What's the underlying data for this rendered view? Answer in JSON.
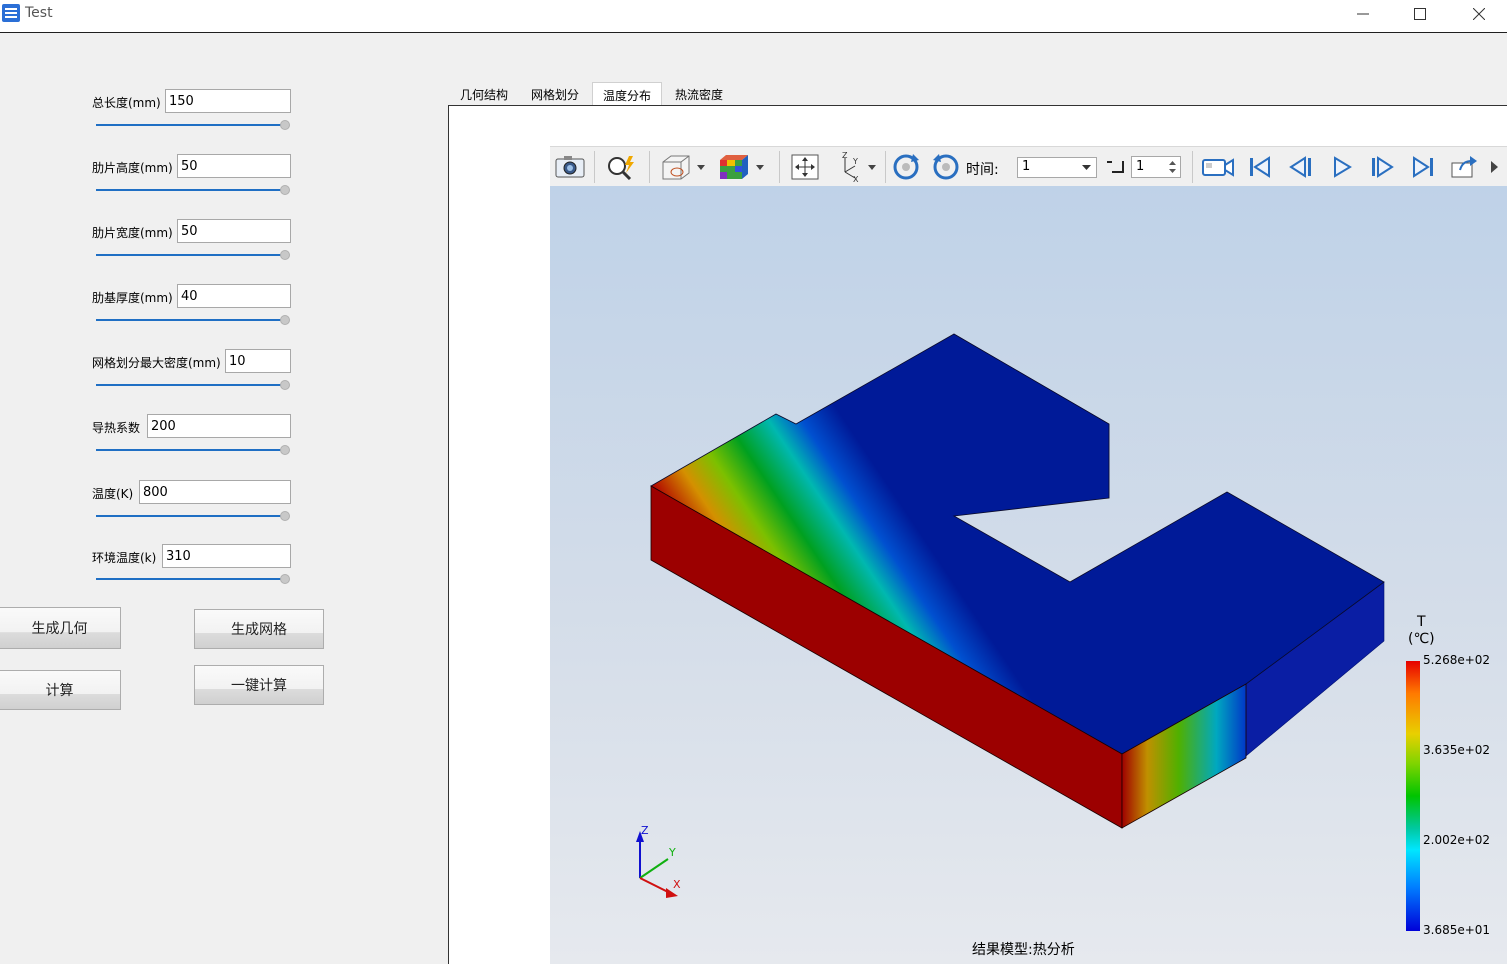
{
  "window": {
    "title": "Test",
    "controls": [
      "minimize",
      "maximize",
      "close"
    ]
  },
  "params": [
    {
      "label": "总长度(mm)",
      "value": "150"
    },
    {
      "label": "肋片高度(mm)",
      "value": "50"
    },
    {
      "label": "肋片宽度(mm)",
      "value": "50"
    },
    {
      "label": "肋基厚度(mm)",
      "value": "40"
    },
    {
      "label": "网格划分最大密度(mm)",
      "value": "10"
    },
    {
      "label": "导热系数",
      "value": "200"
    },
    {
      "label": "温度(K)",
      "value": "800"
    },
    {
      "label": "环境温度(k)",
      "value": "310"
    }
  ],
  "actions": {
    "gen_geometry": "生成几何",
    "gen_mesh": "生成网格",
    "compute": "计算",
    "one_click": "一键计算"
  },
  "tabs": [
    {
      "label": "几何结构",
      "active": false
    },
    {
      "label": "网格划分",
      "active": false
    },
    {
      "label": "温度分布",
      "active": true
    },
    {
      "label": "热流密度",
      "active": false
    }
  ],
  "toolbar": {
    "time_label": "时间:",
    "time_value": "1",
    "step_value": "1",
    "icons": [
      "camera-icon",
      "zoom-icon",
      "display-mode-icon",
      "color-cube-icon",
      "fit-view-icon",
      "axes-icon",
      "rotate-cw-icon",
      "rotate-ccw-icon",
      "record-icon",
      "first-frame-icon",
      "prev-frame-icon",
      "play-icon",
      "next-frame-icon",
      "last-frame-icon",
      "export-icon"
    ]
  },
  "viewport": {
    "legend": {
      "title_line1": "T",
      "title_line2": "(℃)",
      "values": [
        "5.268e+02",
        "3.635e+02",
        "2.002e+02",
        "3.685e+01"
      ]
    },
    "axes_labels": [
      "Z",
      "Y",
      "X"
    ],
    "caption": "结果模型:热分析"
  },
  "colors": {
    "accent": "#1f6fc4",
    "hot": "#c00000",
    "cold": "#0000a8"
  }
}
